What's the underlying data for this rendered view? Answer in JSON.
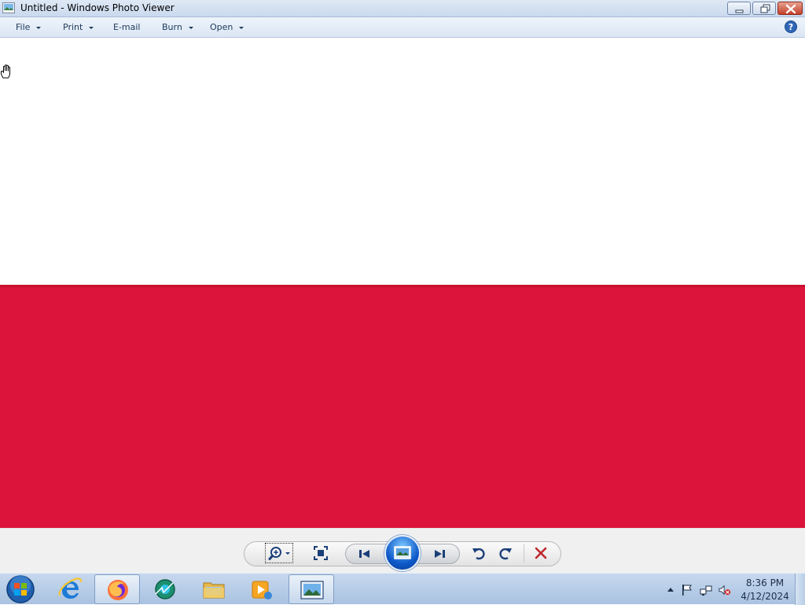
{
  "window": {
    "title": "Untitled - Windows Photo Viewer",
    "title_icon": "photo-viewer-icon",
    "controls": [
      "minimize-icon",
      "restore-icon",
      "close-icon"
    ]
  },
  "menu": {
    "items": [
      {
        "label": "File",
        "has_dropdown": true
      },
      {
        "label": "Print",
        "has_dropdown": true
      },
      {
        "label": "E-mail",
        "has_dropdown": false
      },
      {
        "label": "Burn",
        "has_dropdown": true
      },
      {
        "label": "Open",
        "has_dropdown": true
      }
    ],
    "help_icon": "help-icon"
  },
  "image": {
    "top_color": "#ffffff",
    "bottom_color": "#dc143c",
    "cursor_icon": "hand-pan-icon"
  },
  "toolbar": {
    "buttons": [
      "zoom-icon",
      "actual-size-icon",
      "previous-icon",
      "slideshow-icon",
      "next-icon",
      "rotate-counterclockwise-icon",
      "rotate-clockwise-icon",
      "delete-icon"
    ]
  },
  "taskbar": {
    "start_icon": "windows-start-orb",
    "apps": [
      {
        "name": "internet-explorer-icon",
        "active": false
      },
      {
        "name": "firefox-icon",
        "active": true
      },
      {
        "name": "media-app-icon",
        "active": false
      },
      {
        "name": "file-explorer-icon",
        "active": false
      },
      {
        "name": "media-player-icon",
        "active": false
      },
      {
        "name": "photo-viewer-icon",
        "active": true
      }
    ],
    "tray_icons": [
      "show-hidden-icons-arrow",
      "action-center-flag-icon",
      "network-icon",
      "volume-muted-icon"
    ],
    "clock": {
      "time": "8:36 PM",
      "date": "4/12/2024"
    }
  },
  "colors": {
    "accent": "#0d59c9",
    "titlebar": "#c9d9ee",
    "taskbar": "#a9c2e0",
    "flag_red": "#dc143c"
  }
}
